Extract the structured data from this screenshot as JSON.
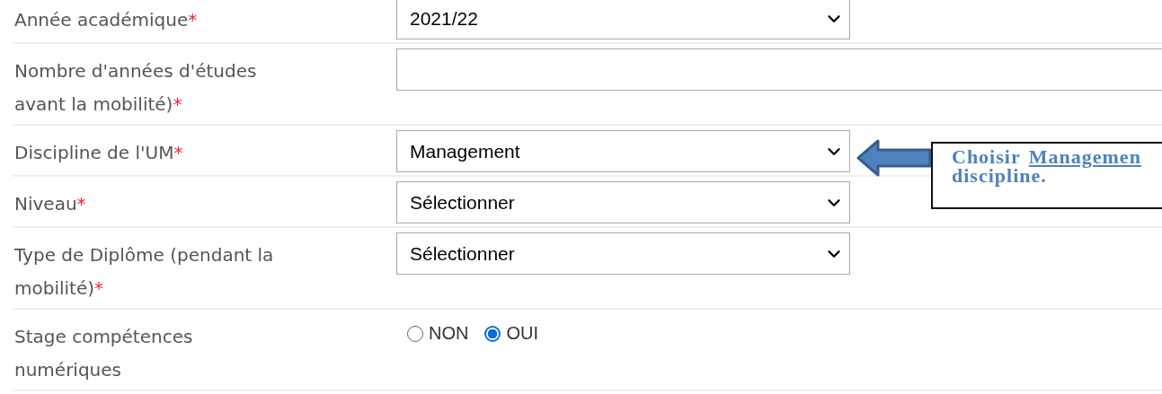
{
  "rows": [
    {
      "label": "Année académique",
      "mark": "*",
      "field": {
        "kind": "select",
        "value": "2021/22"
      }
    },
    {
      "label": "Nombre d'années d'études avant la mobilité)",
      "mark": "*",
      "field": {
        "kind": "text"
      }
    },
    {
      "label": "Discipline de l'UM",
      "mark": "*",
      "field": {
        "kind": "select",
        "value": "Management"
      }
    },
    {
      "label": "Niveau",
      "mark": "*",
      "field": {
        "kind": "select",
        "value": "Sélectionner"
      }
    },
    {
      "label": "Type de Diplôme (pendant la mobilité)",
      "mark": "*",
      "field": {
        "kind": "select",
        "value": "Sélectionner"
      }
    },
    {
      "label": "Stage compétences numériques",
      "field": {
        "kind": "radio",
        "options": [
          {
            "label": "NON",
            "selected": false
          },
          {
            "label": "OUI",
            "selected": true
          }
        ]
      }
    }
  ],
  "callout": {
    "line_1": [
      {
        "text": "Choisir",
        "underline": false
      },
      {
        "text": "Managemen",
        "underline": true
      }
    ],
    "line_2": "discipline."
  }
}
